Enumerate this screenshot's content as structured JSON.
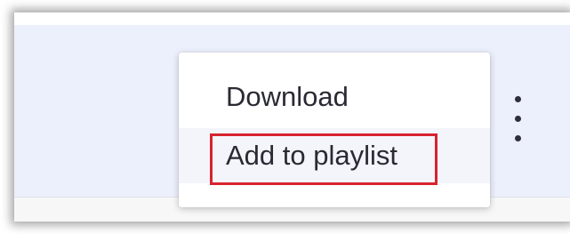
{
  "menu": {
    "items": [
      {
        "label": "Download"
      },
      {
        "label": "Add to playlist"
      }
    ]
  },
  "more_button": {
    "icon": "more-vertical-icon"
  },
  "colors": {
    "row_background": "#eceffc",
    "highlight_border": "#d8232f",
    "menu_text": "#2a2a34"
  }
}
